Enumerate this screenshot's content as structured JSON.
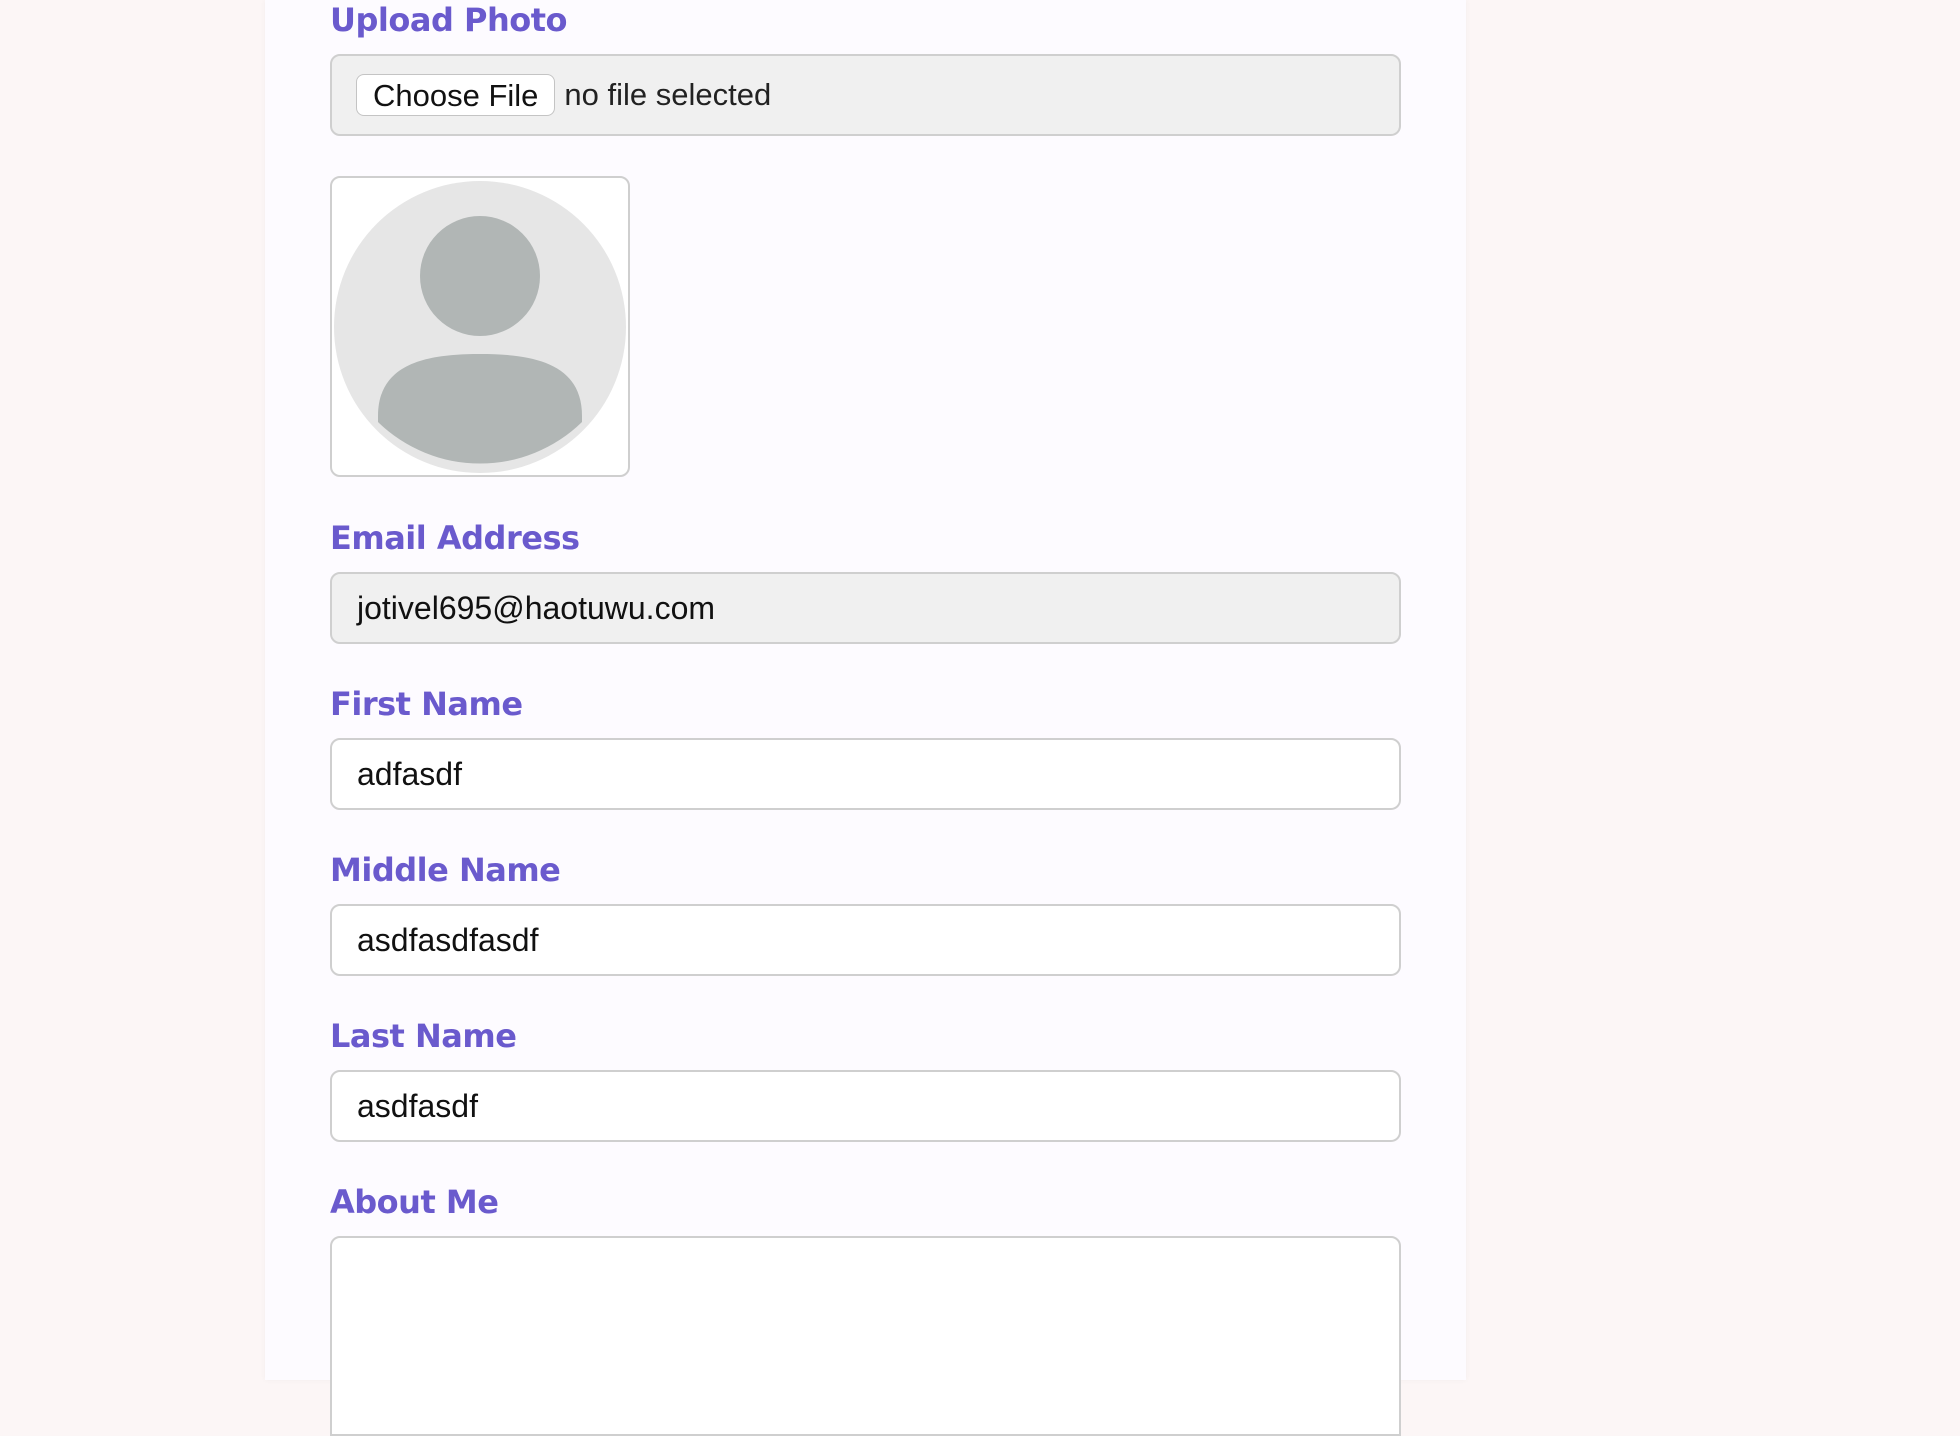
{
  "form": {
    "upload_photo": {
      "label": "Upload Photo",
      "button_label": "Choose File",
      "status_text": "no file selected"
    },
    "avatar": {
      "icon": "user-avatar-placeholder-icon"
    },
    "email": {
      "label": "Email Address",
      "value": "jotivel695@haotuwu.com"
    },
    "first_name": {
      "label": "First Name",
      "value": "adfasdf"
    },
    "middle_name": {
      "label": "Middle Name",
      "value": "asdfasdfasdf"
    },
    "last_name": {
      "label": "Last Name",
      "value": "asdfasdf"
    },
    "about_me": {
      "label": "About Me",
      "value": ""
    }
  },
  "colors": {
    "page_background": "#fcf6f6",
    "card_background": "#fdfbff",
    "label": "#6a5acd",
    "field_border": "#cfcfcf",
    "readonly_field_background": "#f0f0f0",
    "avatar_circle": "#e6e6e6",
    "avatar_figure": "#b1b6b5"
  }
}
